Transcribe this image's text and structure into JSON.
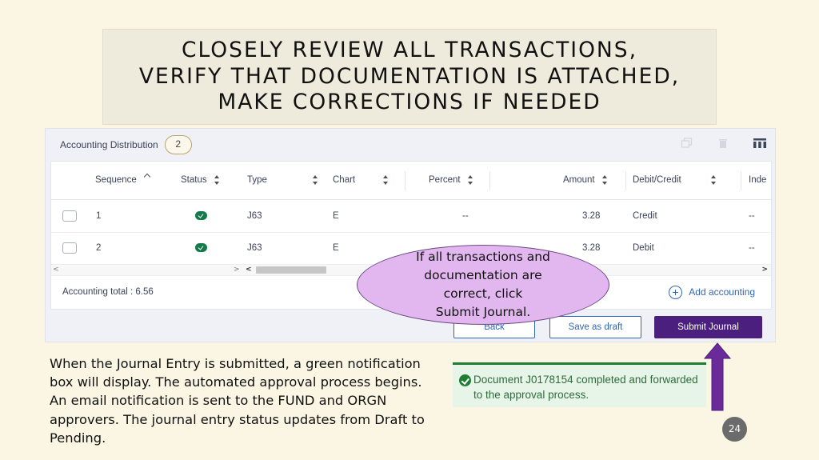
{
  "slide": {
    "title_lines": [
      "CLOSELY REVIEW ALL TRANSACTIONS,",
      "VERIFY THAT DOCUMENTATION IS ATTACHED,",
      "MAKE CORRECTIONS IF NEEDED"
    ],
    "page_number": "24",
    "colors": {
      "background": "#fbf6e4",
      "title_box": "#efebdc",
      "bubble": "#e2b6ee",
      "arrow": "#6a2a9a",
      "submit_button": "#4b1f7e"
    }
  },
  "panel": {
    "title": "Accounting Distribution",
    "count": "2",
    "toolbar_icons": [
      "copy-icon",
      "trash-icon",
      "columns-icon"
    ],
    "columns": [
      "Sequence",
      "Status",
      "Type",
      "Chart",
      "Percent",
      "Amount",
      "Debit/Credit",
      "Inde"
    ],
    "rows": [
      {
        "sequence": "1",
        "status": "check-icon",
        "type": "J63",
        "chart": "E",
        "percent": "--",
        "amount": "3.28",
        "debit_credit": "Credit",
        "index": "--"
      },
      {
        "sequence": "2",
        "status": "check-icon",
        "type": "J63",
        "chart": "E",
        "percent": "",
        "amount": "3.28",
        "debit_credit": "Debit",
        "index": "--"
      }
    ],
    "total": "Accounting total : 6.56",
    "add_accounting": "Add accounting",
    "buttons": {
      "back": "Back",
      "save_draft": "Save as draft",
      "submit": "Submit Journal"
    }
  },
  "callout": {
    "text_lines": [
      "If all transactions and",
      "documentation are",
      "correct, click",
      "Submit Journal."
    ]
  },
  "body": {
    "text": "When the Journal Entry is submitted, a green notification box will display.  The automated approval process begins.  An email notification is sent to the FUND and ORGN approvers.  The journal entry status updates from Draft to Pending."
  },
  "notification": {
    "text": "Document J0178154 completed and forwarded to the approval process."
  }
}
